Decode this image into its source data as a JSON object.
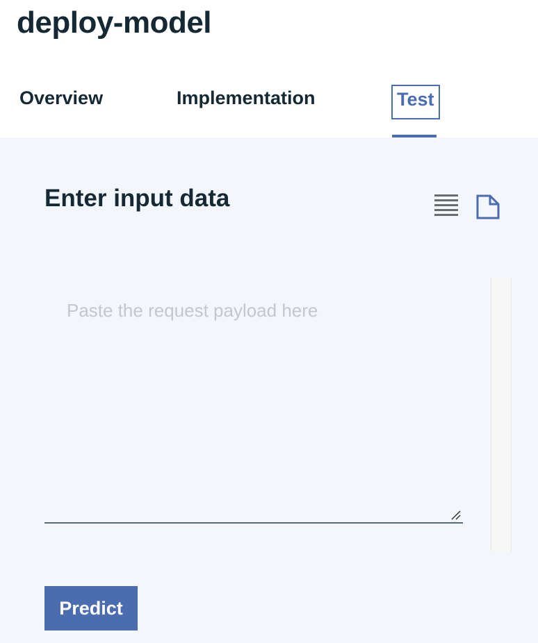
{
  "page": {
    "title": "deploy-model"
  },
  "tabs": [
    {
      "label": "Overview"
    },
    {
      "label": "Implementation"
    },
    {
      "label": "Test"
    }
  ],
  "active_tab": "Test",
  "section": {
    "title": "Enter input data",
    "icons": [
      "list-view-icon",
      "file-icon"
    ]
  },
  "payload_input": {
    "value": "",
    "placeholder": "Paste the request payload here"
  },
  "predict_button": {
    "label": "Predict"
  },
  "colors": {
    "accent": "#4b6db0",
    "text": "#152935",
    "panel_bg": "#f3f6fb",
    "placeholder": "#c3c8cd"
  }
}
